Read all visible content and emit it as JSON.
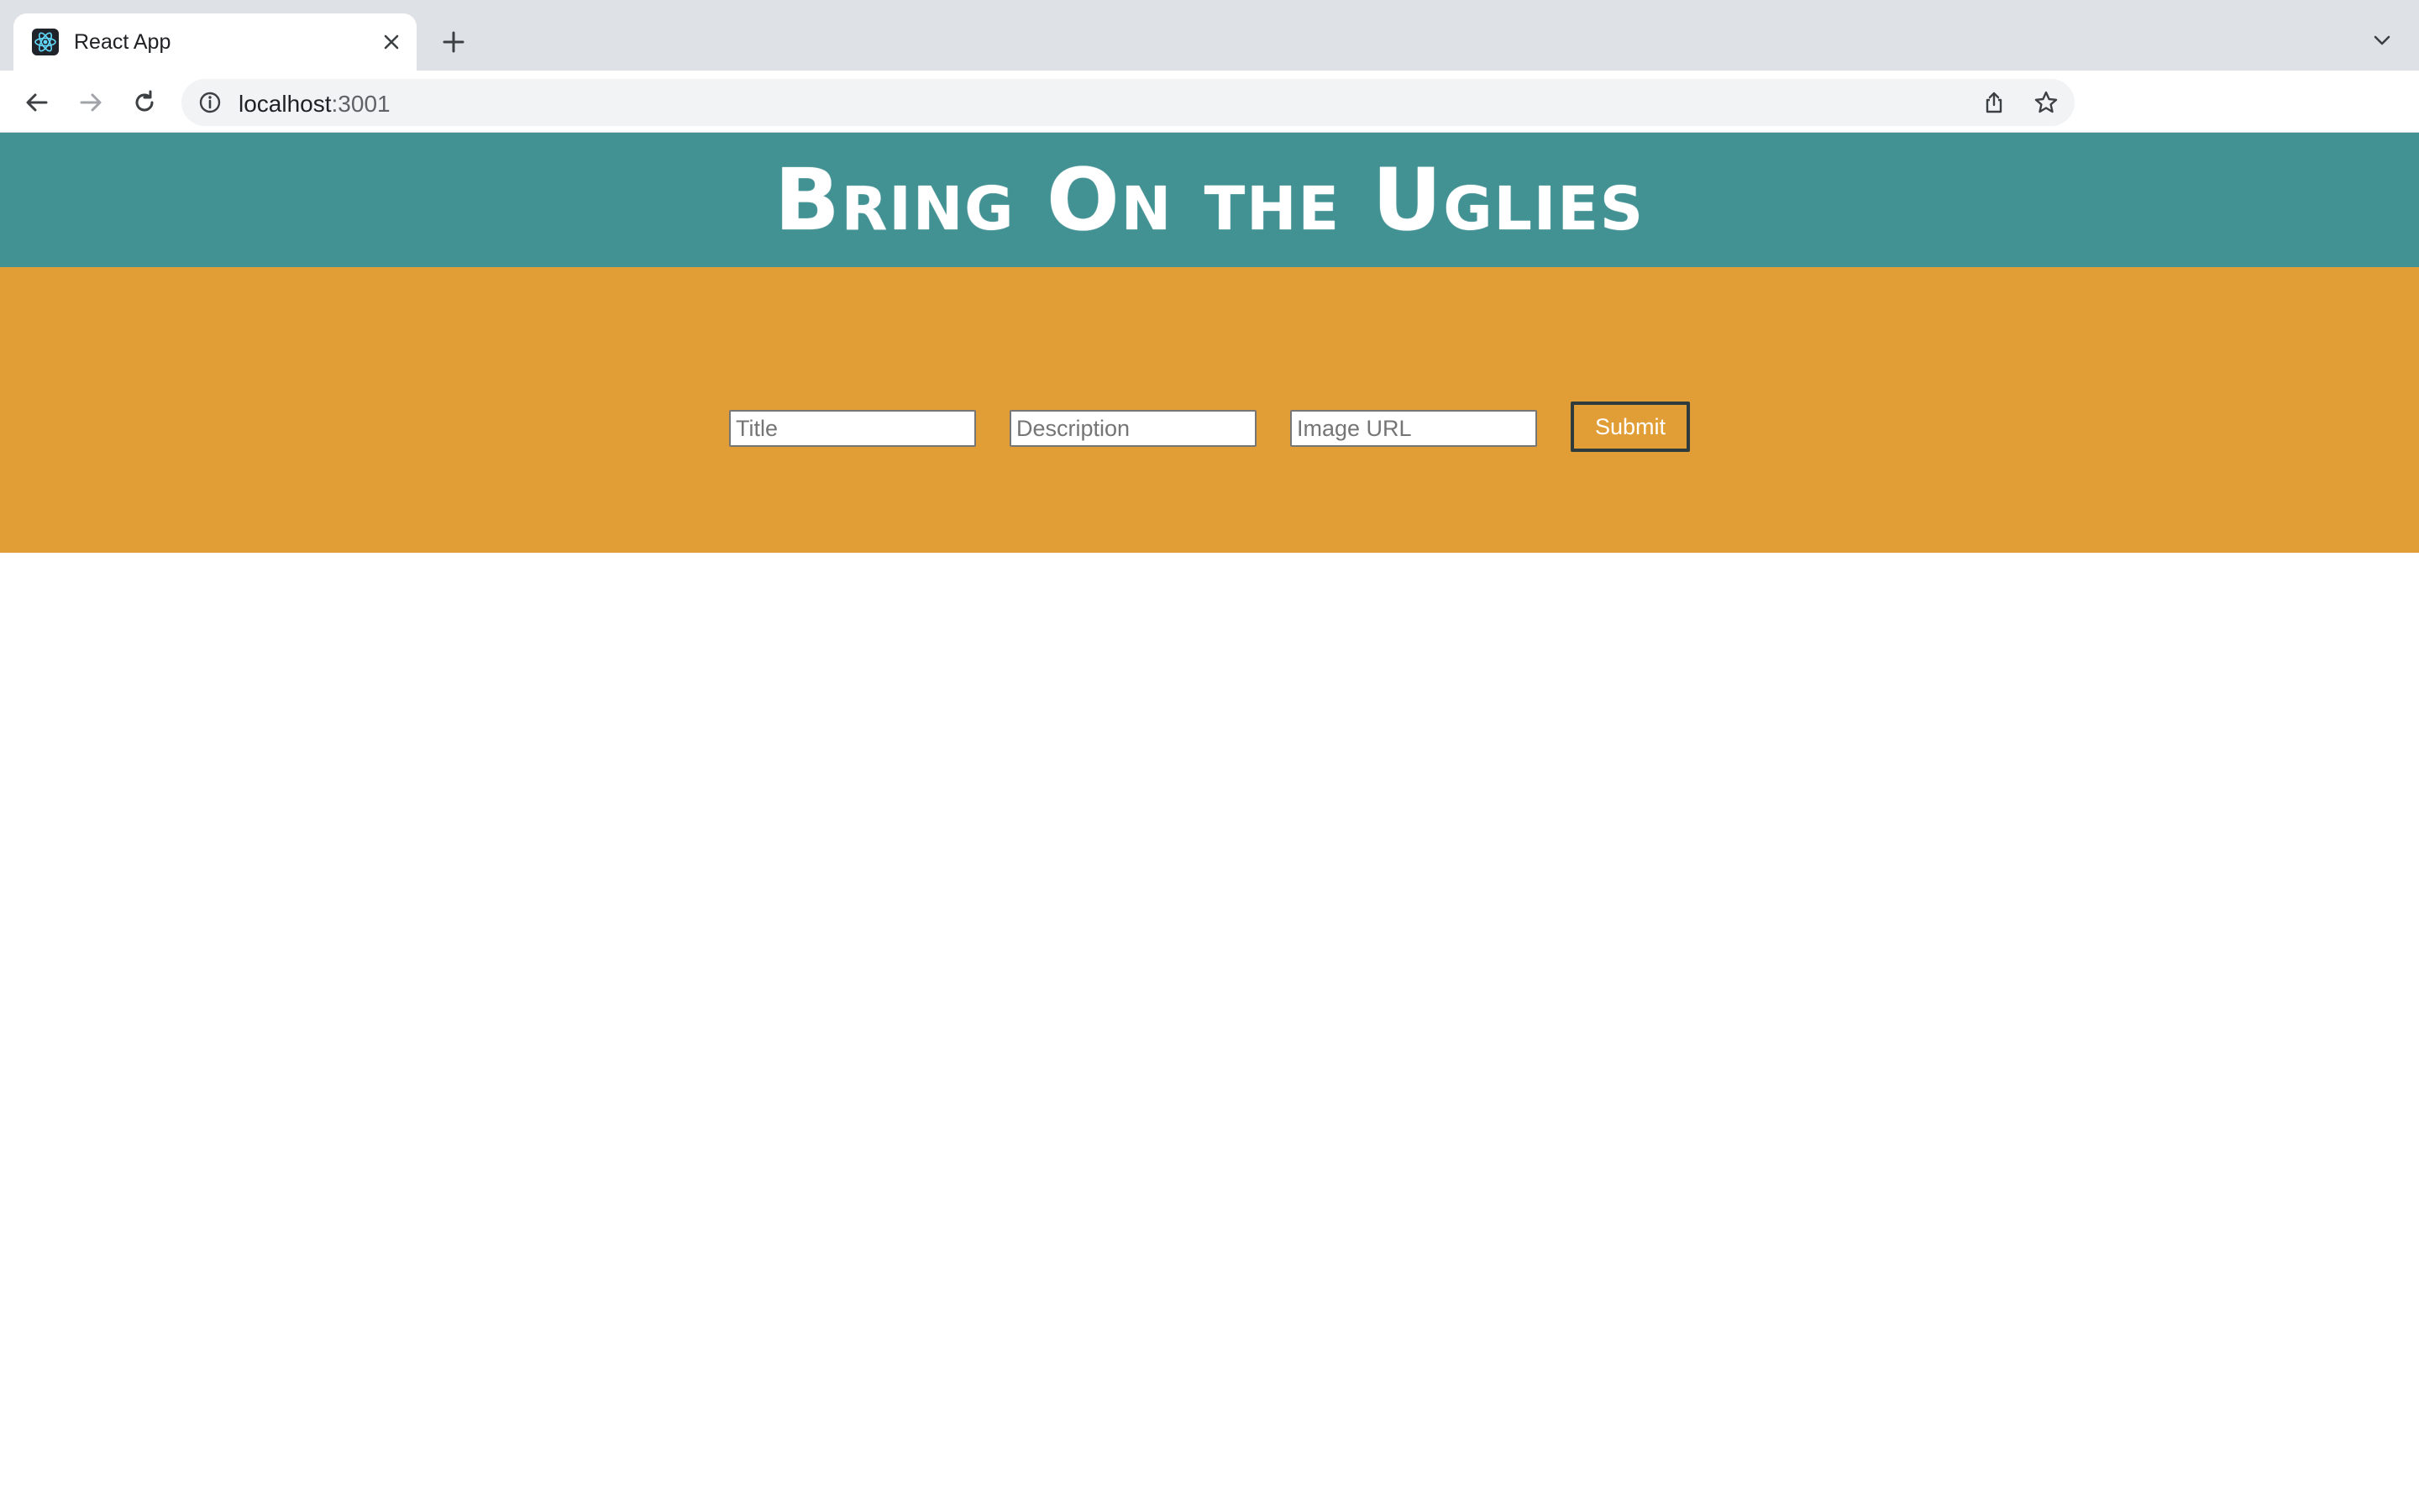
{
  "browser": {
    "tab": {
      "title": "React App",
      "favicon": "react-logo-icon"
    },
    "address_bar": {
      "host": "localhost",
      "port": ":3001"
    },
    "icons": {
      "back": "arrow-left-icon",
      "forward": "arrow-right-icon",
      "reload": "reload-icon",
      "info": "info-icon",
      "share": "share-icon",
      "bookmark": "star-icon",
      "extensions": "puzzle-icon",
      "side_panel": "side-panel-icon",
      "menu": "kebab-menu-icon"
    }
  },
  "header": {
    "title": "Bring On the Uglies",
    "background": "#429193"
  },
  "form": {
    "background": "#e19e36",
    "title_placeholder": "Title",
    "description_placeholder": "Description",
    "image_url_placeholder": "Image URL",
    "submit_label": "Submit"
  }
}
